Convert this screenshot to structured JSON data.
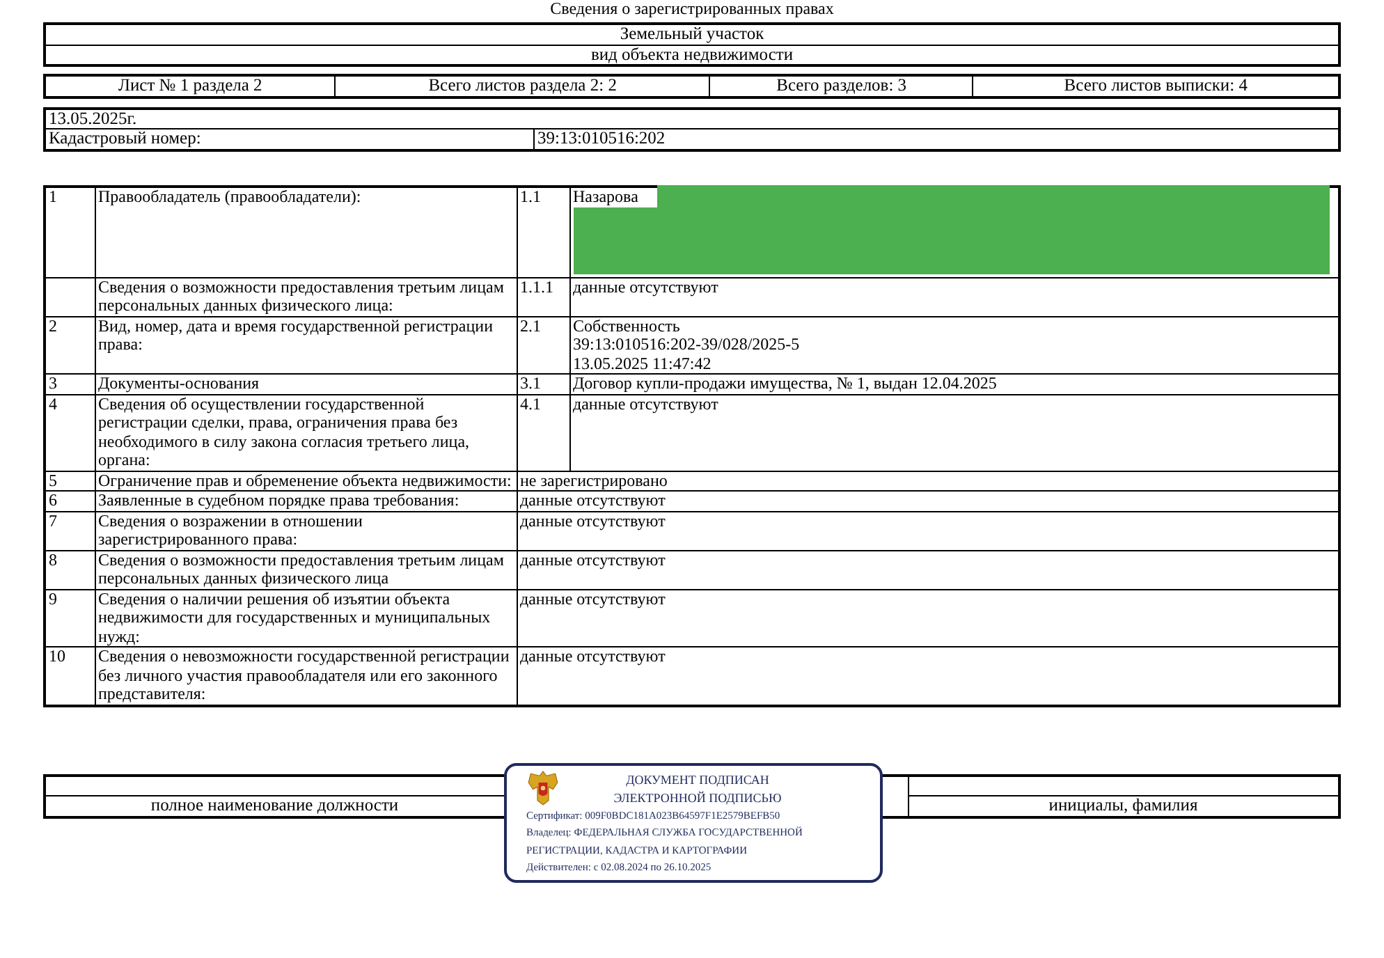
{
  "header_title": "Сведения о зарегистрированных правах",
  "object": {
    "type": "Земельный участок",
    "caption": "вид объекта недвижимости"
  },
  "sheet_info": [
    "Лист № 1 раздела 2",
    "Всего листов раздела 2: 2",
    "Всего разделов: 3",
    "Всего листов выписки: 4"
  ],
  "date": "13.05.2025г.",
  "cadastral": {
    "label": "Кадастровый номер:",
    "value": "39:13:010516:202"
  },
  "rows": [
    {
      "kind": "split",
      "number": "1",
      "label": "Правообладатель (правообладатели):",
      "sub_number": "1.1",
      "value": [
        "Назарова"
      ],
      "redacted": true
    },
    {
      "kind": "split",
      "number": "",
      "label": "Сведения о возможности предоставления третьим лицам персональных данных физического лица:",
      "sub_number": "1.1.1",
      "value": [
        "данные отсутствуют"
      ],
      "redacted": false
    },
    {
      "kind": "split",
      "number": "2",
      "label": "Вид, номер, дата и время государственной регистрации права:",
      "sub_number": "2.1",
      "value": [
        "Собственность",
        "39:13:010516:202-39/028/2025-5",
        "13.05.2025 11:47:42"
      ],
      "redacted": false
    },
    {
      "kind": "split",
      "number": "3",
      "label": "Документы-основания",
      "sub_number": "3.1",
      "value": [
        "Договор купли-продажи имущества, № 1, выдан 12.04.2025"
      ],
      "redacted": false
    },
    {
      "kind": "split",
      "number": "4",
      "label": "Сведения об осуществлении государственной регистрации сделки, права, ограничения права без необходимого в силу закона согласия третьего лица, органа:",
      "sub_number": "4.1",
      "value": [
        "данные отсутствуют"
      ],
      "redacted": false
    },
    {
      "kind": "merged",
      "number": "5",
      "label": "Ограничение прав и обременение объекта недвижимости:",
      "value": [
        "не зарегистрировано"
      ],
      "redacted": false
    },
    {
      "kind": "merged",
      "number": "6",
      "label": "Заявленные в судебном порядке права требования:",
      "value": [
        "данные отсутствуют"
      ],
      "redacted": false
    },
    {
      "kind": "merged",
      "number": "7",
      "label": "Сведения о возражении в отношении зарегистрированного права:",
      "value": [
        "данные отсутствуют"
      ],
      "redacted": false
    },
    {
      "kind": "merged",
      "number": "8",
      "label": "Сведения о возможности предоставления третьим лицам персональных данных физического лица",
      "value": [
        "данные отсутствуют"
      ],
      "redacted": false
    },
    {
      "kind": "merged",
      "number": "9",
      "label": "Сведения о наличии решения об изъятии объекта недвижимости для государственных и муниципальных нужд:",
      "value": [
        "данные отсутствуют"
      ],
      "redacted": false
    },
    {
      "kind": "merged",
      "number": "10",
      "label": "Сведения о невозможности государственной регистрации без личного участия правообладателя или его законного представителя:",
      "value": [
        "данные отсутствуют"
      ],
      "redacted": false
    }
  ],
  "signature": {
    "left_caption": "полное наименование должности",
    "right_caption": "инициалы, фамилия",
    "stamp": {
      "line1": "ДОКУМЕНТ ПОДПИСАН",
      "line2": "ЭЛЕКТРОННОЙ ПОДПИСЬЮ",
      "certificate": "Сертификат: 009F0BDC181A023B64597F1E2579BEFB50",
      "owner": "Владелец: ФЕДЕРАЛЬНАЯ СЛУЖБА ГОСУДАРСТВЕННОЙ",
      "owner_cont": "РЕГИСТРАЦИИ, КАДАСТРА И КАРТОГРАФИИ",
      "validity": "Действителен: с 02.08.2024 по 26.10.2025"
    }
  }
}
